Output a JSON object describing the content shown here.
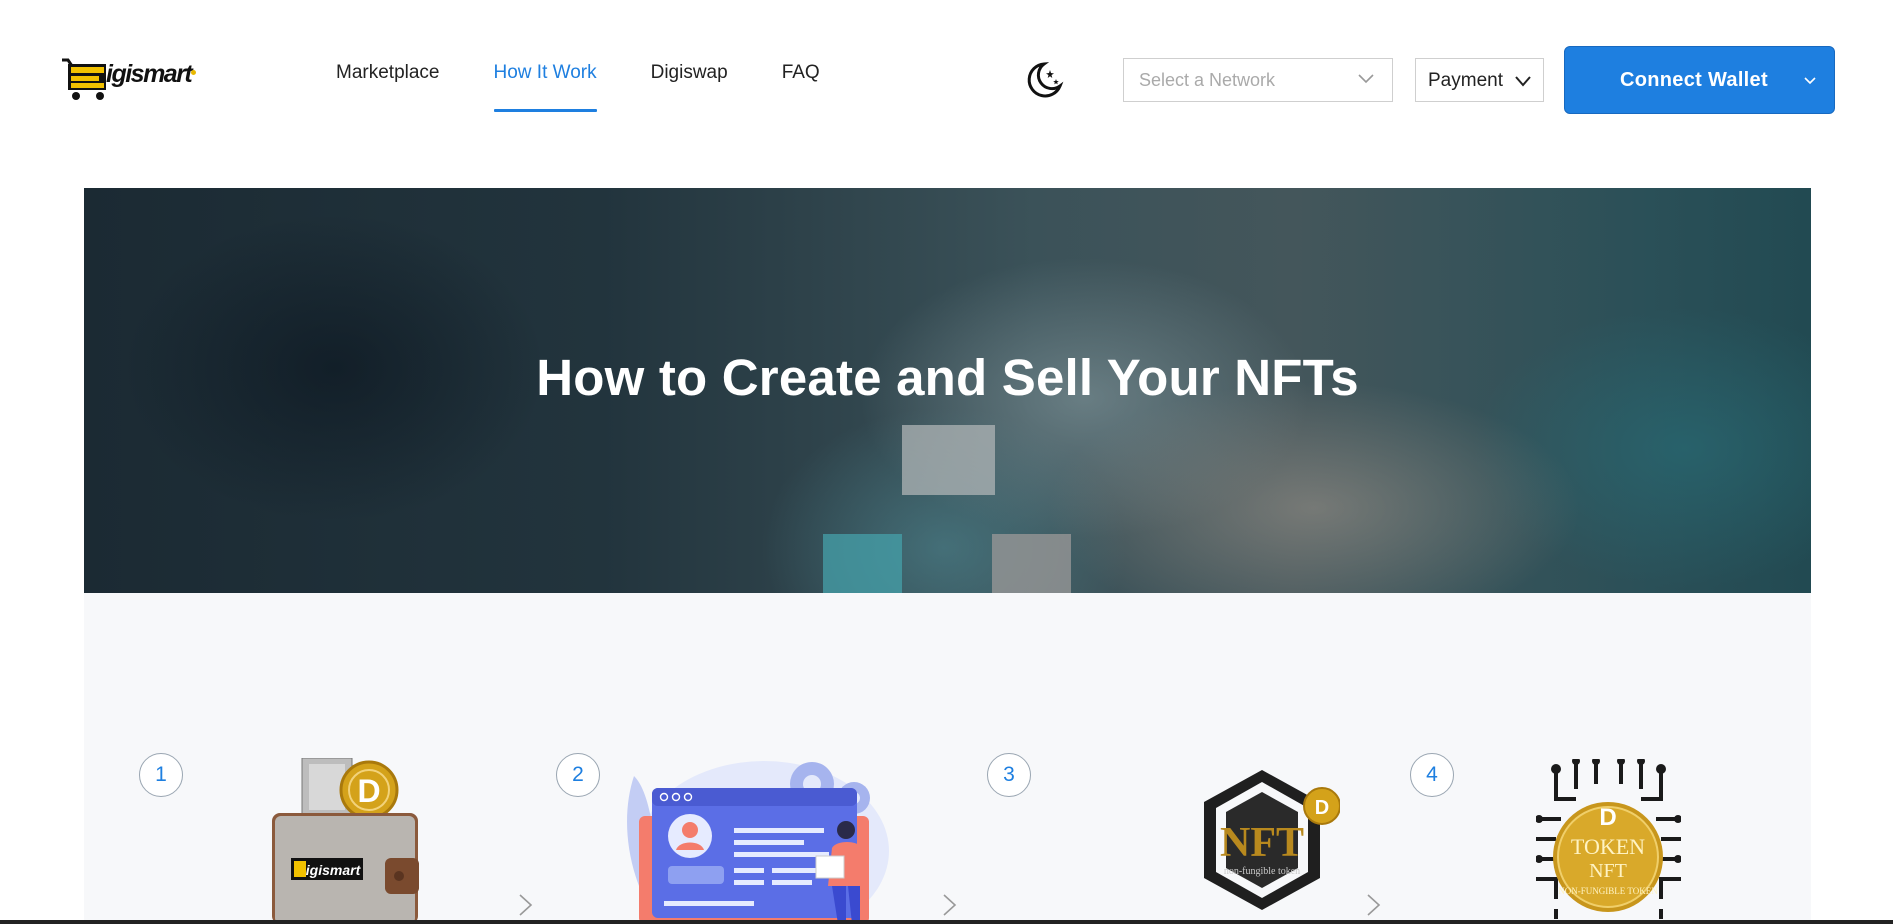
{
  "header": {
    "logo": {
      "text": "igismart",
      "icon": "cart-logo-icon"
    },
    "nav": [
      {
        "label": "Marketplace",
        "active": false
      },
      {
        "label": "How It Work",
        "active": true
      },
      {
        "label": "Digiswap",
        "active": false
      },
      {
        "label": "FAQ",
        "active": false
      }
    ],
    "theme_toggle_icon": "moon-stars-icon",
    "network_select": {
      "placeholder": "Select a Network"
    },
    "payment_select": {
      "value": "Payment"
    },
    "connect_button": {
      "label": "Connect Wallet"
    }
  },
  "hero": {
    "title": "How to Create and Sell Your NFTs"
  },
  "steps": [
    {
      "number": "1",
      "image": "wallet-image"
    },
    {
      "number": "2",
      "image": "creator-dashboard-image"
    },
    {
      "number": "3",
      "image": "nft-hexagon-image"
    },
    {
      "number": "4",
      "image": "token-nft-coin-image"
    }
  ],
  "colors": {
    "accent": "#1e7fe0",
    "logo_yellow": "#e8b800",
    "steps_background": "#f7f8fa"
  }
}
